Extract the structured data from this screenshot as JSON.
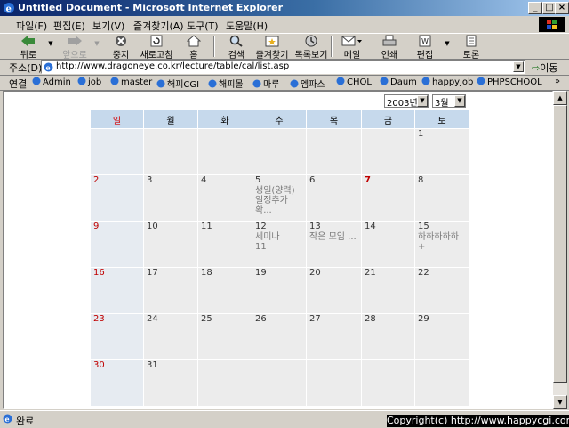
{
  "window": {
    "title": "Untitled Document - Microsoft Internet Explorer",
    "minimize": "_",
    "maximize": "□",
    "close": "×"
  },
  "menu": [
    "파일(F)",
    "편집(E)",
    "보기(V)",
    "즐겨찾기(A)",
    "도구(T)",
    "도움말(H)"
  ],
  "toolbar": {
    "back": "뒤로",
    "forward": "앞으로",
    "stop": "중지",
    "refresh": "새로고침",
    "home": "홈",
    "search": "검색",
    "favorites": "즐겨찾기",
    "history": "목록보기",
    "mail": "메일",
    "print": "인쇄",
    "edit": "편집",
    "discuss": "토론"
  },
  "address": {
    "label": "주소(D)",
    "url": "http://www.dragoneye.co.kr/lecture/table/cal/list.asp",
    "go": "이동"
  },
  "links": {
    "label": "연결",
    "items": [
      "Admin",
      "job",
      "master",
      "해피CGI",
      "해피몰",
      "마루",
      "엠파스",
      "CHOL",
      "Daum",
      "happyjob",
      "PHPSCHOOL"
    ],
    "more": "»"
  },
  "calendar": {
    "year": "2003년",
    "month": "3월",
    "weekdays": [
      "일",
      "월",
      "화",
      "수",
      "목",
      "금",
      "토"
    ],
    "weeks": [
      [
        {
          "d": ""
        },
        {
          "d": ""
        },
        {
          "d": ""
        },
        {
          "d": ""
        },
        {
          "d": ""
        },
        {
          "d": ""
        },
        {
          "d": "1"
        }
      ],
      [
        {
          "d": "2"
        },
        {
          "d": "3"
        },
        {
          "d": "4"
        },
        {
          "d": "5",
          "e": [
            "생일(양력)",
            "일정추가",
            "확..."
          ]
        },
        {
          "d": "6"
        },
        {
          "d": "7",
          "holiday": true
        },
        {
          "d": "8"
        }
      ],
      [
        {
          "d": "9"
        },
        {
          "d": "10"
        },
        {
          "d": "11"
        },
        {
          "d": "12",
          "e": [
            "세미나",
            "11"
          ]
        },
        {
          "d": "13",
          "e": [
            "작은 모임 ..."
          ]
        },
        {
          "d": "14"
        },
        {
          "d": "15",
          "e": [
            "하하하하하+"
          ]
        }
      ],
      [
        {
          "d": "16"
        },
        {
          "d": "17"
        },
        {
          "d": "18"
        },
        {
          "d": "19"
        },
        {
          "d": "20"
        },
        {
          "d": "21"
        },
        {
          "d": "22"
        }
      ],
      [
        {
          "d": "23"
        },
        {
          "d": "24"
        },
        {
          "d": "25"
        },
        {
          "d": "26"
        },
        {
          "d": "27"
        },
        {
          "d": "28"
        },
        {
          "d": "29"
        }
      ],
      [
        {
          "d": "30"
        },
        {
          "d": "31"
        },
        {
          "d": ""
        },
        {
          "d": ""
        },
        {
          "d": ""
        },
        {
          "d": ""
        },
        {
          "d": ""
        }
      ]
    ]
  },
  "status": {
    "text": "완료",
    "copyright": "Copyright(c) http://www.happycgi.com"
  },
  "colors": {
    "title_start": "#0a246a",
    "sunday": "#c00000",
    "header": "#c6d9ec"
  }
}
